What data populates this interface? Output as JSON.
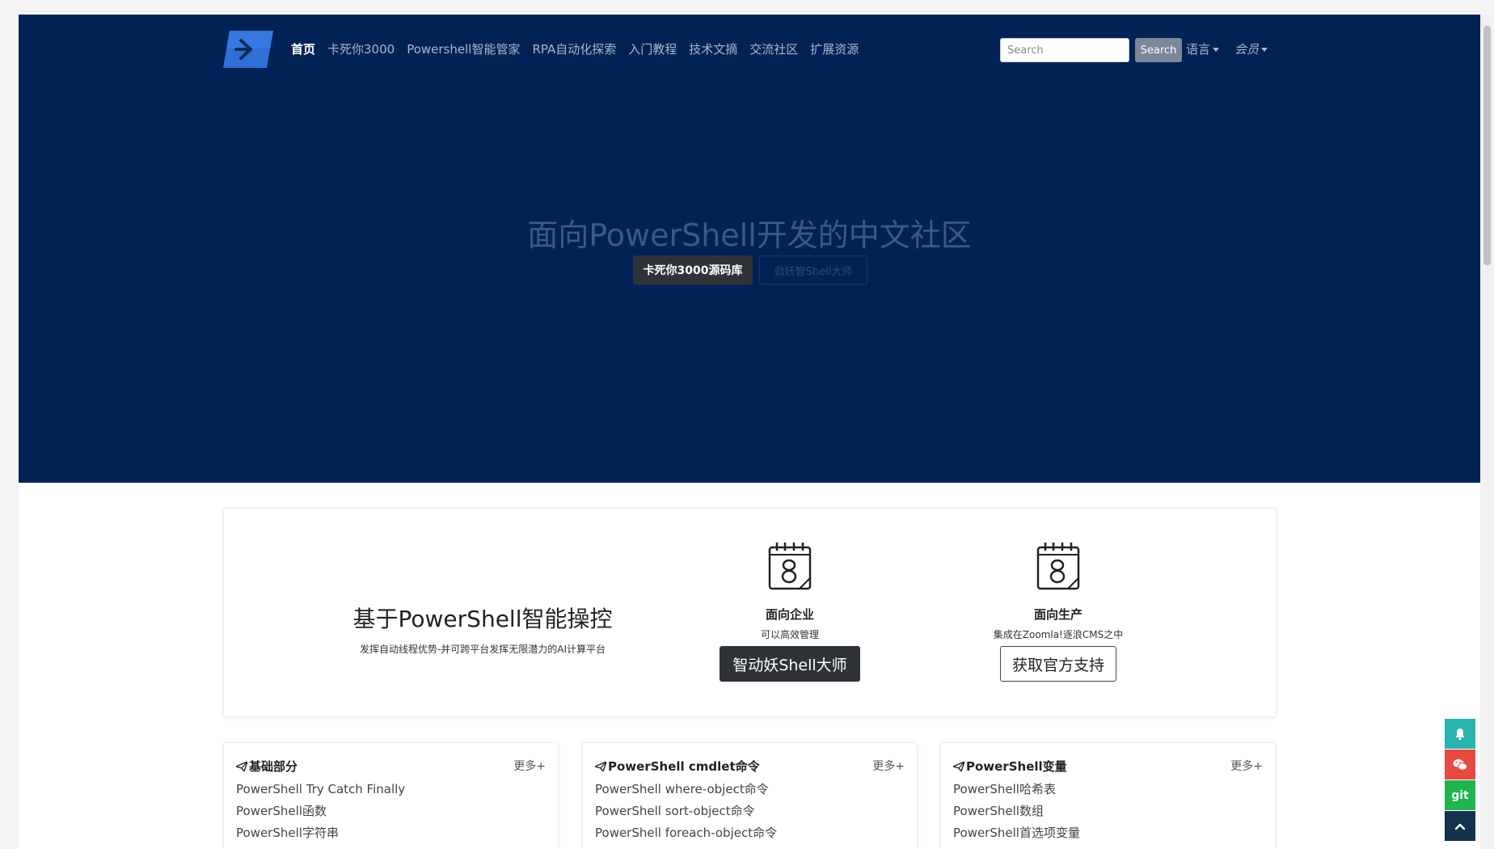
{
  "nav": {
    "items": [
      {
        "label": "首页",
        "active": true
      },
      {
        "label": "卡死你3000",
        "active": false
      },
      {
        "label": "Powershell智能管家",
        "active": false
      },
      {
        "label": "RPA自动化探索",
        "active": false
      },
      {
        "label": "入门教程",
        "active": false
      },
      {
        "label": "技术文摘",
        "active": false
      },
      {
        "label": "交流社区",
        "active": false
      },
      {
        "label": "扩展资源",
        "active": false
      }
    ],
    "search_placeholder": "Search",
    "search_button": "Search",
    "language_label": "语言",
    "member_label": "会员"
  },
  "hero": {
    "title": "面向PowerShell开发的中文社区",
    "primary_button": "卡死你3000源码库",
    "secondary_button": "劲妖智Shell大师",
    "background_color": "#002255"
  },
  "feature": {
    "title": "基于PowerShell智能操控",
    "subtitle": "发挥自动线程优势-并可跨平台发挥无限潜力的AI计算平台",
    "columns": [
      {
        "icon": "calendar-8-icon",
        "heading": "面向企业",
        "text": "可以高效管理",
        "button": "智动妖Shell大师"
      },
      {
        "icon": "calendar-8-icon",
        "heading": "面向生产",
        "text": "集成在Zoomla!逐浪CMS之中",
        "button": "获取官方支持"
      }
    ]
  },
  "cards": [
    {
      "title": "基础部分",
      "more": "更多+",
      "items": [
        "PowerShell Try Catch Finally",
        "PowerShell函数",
        "PowerShell字符串"
      ]
    },
    {
      "title": "PowerShell cmdlet命令",
      "more": "更多+",
      "items": [
        "PowerShell where-object命令",
        "PowerShell sort-object命令",
        "PowerShell foreach-object命令"
      ]
    },
    {
      "title": "PowerShell变量",
      "more": "更多+",
      "items": [
        "PowerShell哈希表",
        "PowerShell数组",
        "PowerShell首选项变量"
      ]
    }
  ],
  "side_buttons": {
    "git_label": "git",
    "colors": {
      "bell": "#27b3b0",
      "chat": "#e8483d",
      "git": "#1fb44e",
      "top": "#12324e"
    }
  }
}
